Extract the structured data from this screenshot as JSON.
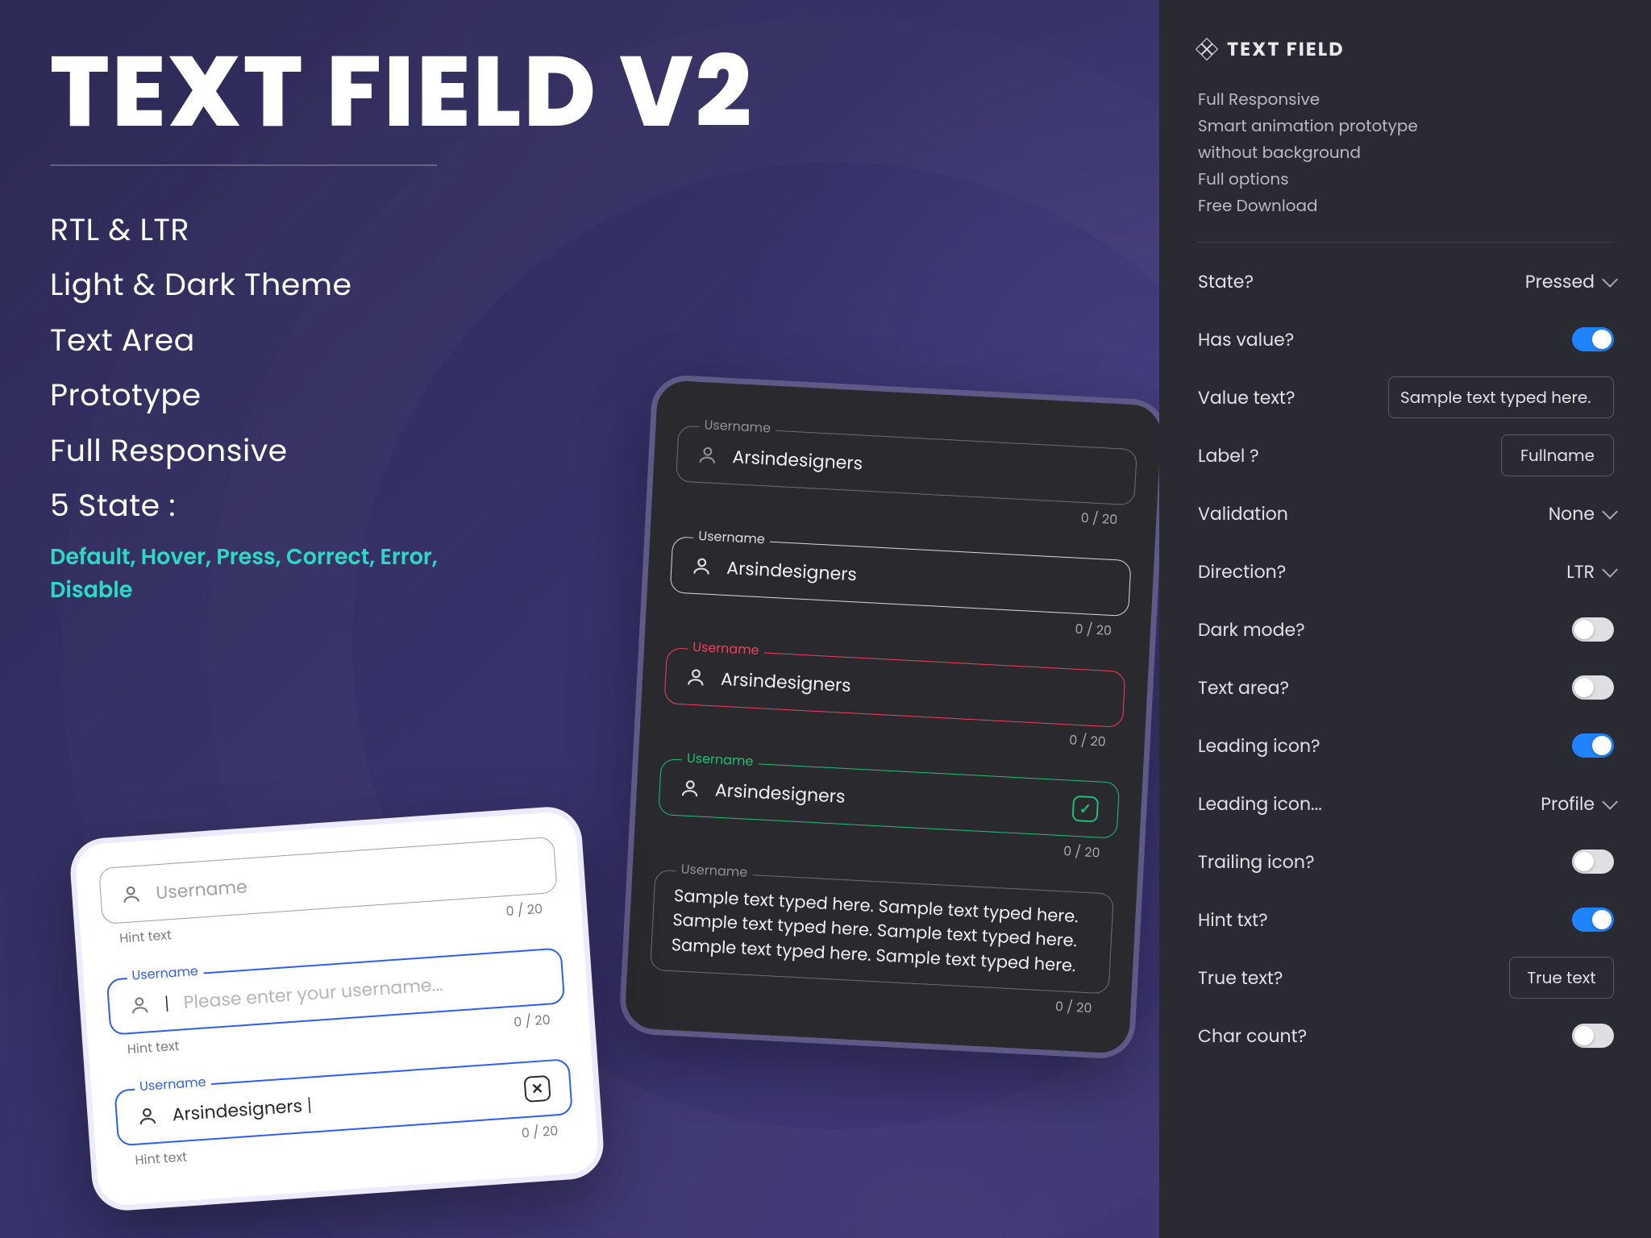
{
  "hero": {
    "title": "TEXT FIELD V2",
    "features": [
      "RTL & LTR",
      "Light & Dark Theme",
      "Text Area",
      "Prototype",
      "Full Responsive",
      "5 State :"
    ],
    "states_line": "Default, Hover, Press, Correct, Error, Disable"
  },
  "dark_phone": {
    "fields": [
      {
        "label": "Username",
        "value": "Arsindesigners",
        "counter": "0 / 20",
        "variant": "gray"
      },
      {
        "label": "Username",
        "value": "Arsindesigners",
        "counter": "0 / 20",
        "variant": "white"
      },
      {
        "label": "Username",
        "value": "Arsindesigners",
        "counter": "0 / 20",
        "variant": "red"
      },
      {
        "label": "Username",
        "value": "Arsindesigners",
        "counter": "0 / 20",
        "variant": "green",
        "check": true
      }
    ],
    "textarea": {
      "label": "Username",
      "value": "Sample text typed here. Sample text typed here. Sample text typed here. Sample text typed here. Sample text typed here. Sample text typed here.",
      "counter": "0 / 20"
    }
  },
  "light_phone": {
    "fields": [
      {
        "value": "Username",
        "as_label_inside": true,
        "counter": "0 / 20",
        "hint": "Hint text",
        "variant": "gray"
      },
      {
        "label": "Username",
        "placeholder": "Please enter your username...",
        "counter": "0 / 20",
        "hint": "Hint text",
        "variant": "blue",
        "caret": true
      },
      {
        "label": "Username",
        "value": "Arsindesigners",
        "counter": "0 / 20",
        "hint": "Hint text",
        "variant": "blue-thick",
        "x": true,
        "caret": true
      }
    ]
  },
  "sidebar": {
    "title": "TEXT FIELD",
    "description": [
      "Full Responsive",
      "Smart animation prototype",
      "without background",
      "Full options",
      "Free Download"
    ],
    "props": {
      "state": {
        "label": "State?",
        "value": "Pressed"
      },
      "has_value": {
        "label": "Has value?",
        "value": true
      },
      "value_text": {
        "label": "Value text?",
        "value": "Sample text typed here."
      },
      "label_text": {
        "label": "Label ?",
        "value": "Fullname"
      },
      "validation": {
        "label": "Validation",
        "value": "None"
      },
      "direction": {
        "label": "Direction?",
        "value": "LTR"
      },
      "dark_mode": {
        "label": "Dark mode?",
        "value": false
      },
      "text_area": {
        "label": "Text area?",
        "value": false
      },
      "leading_icon": {
        "label": "Leading icon?",
        "value": true
      },
      "leading_icon_type": {
        "label": "Leading icon...",
        "value": "Profile"
      },
      "trailing_icon": {
        "label": "Trailing icon?",
        "value": false
      },
      "hint_txt": {
        "label": "Hint txt?",
        "value": true
      },
      "true_text": {
        "label": "True text?",
        "value": "True text"
      },
      "char_count": {
        "label": "Char count?",
        "value": false
      }
    }
  }
}
